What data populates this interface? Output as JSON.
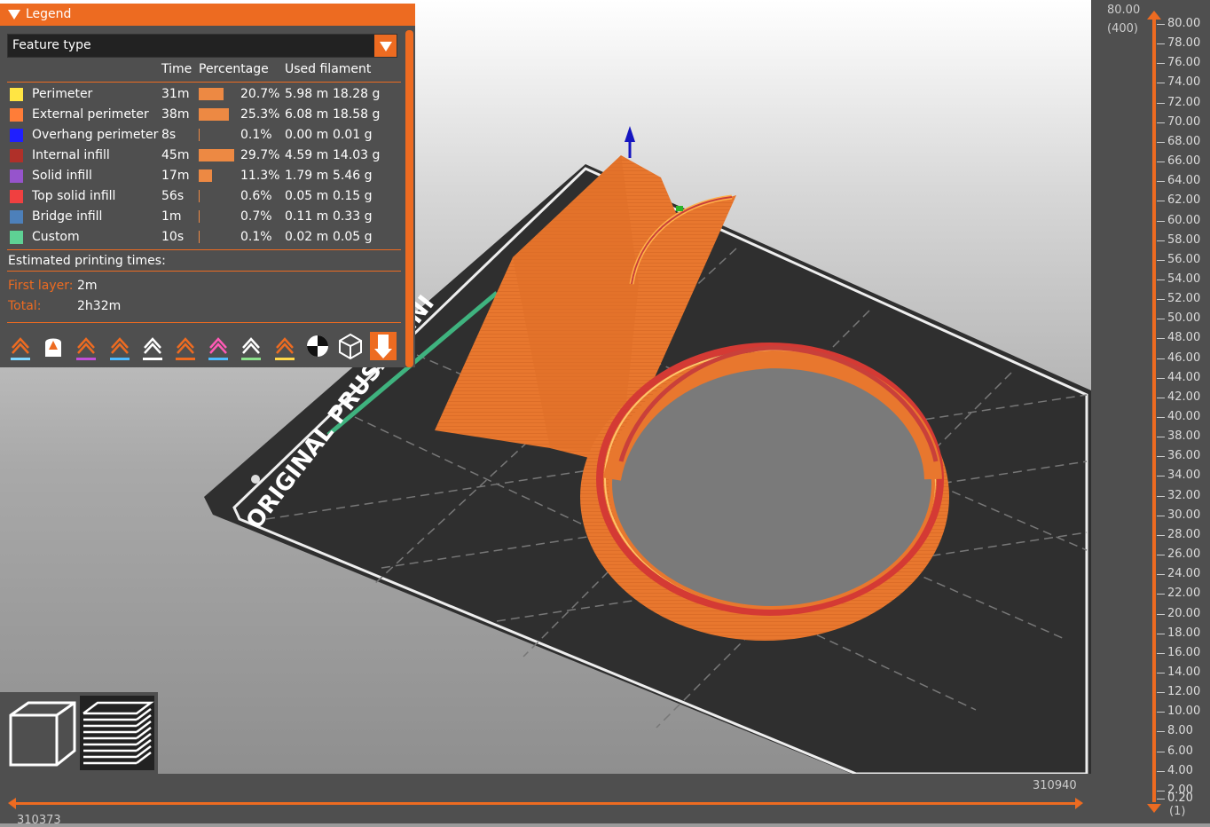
{
  "legend": {
    "title": "Legend",
    "view_type": "Feature type",
    "columns": [
      "Time",
      "Percentage",
      "Used filament"
    ],
    "rows": [
      {
        "name": "Perimeter",
        "color": "#ffe543",
        "time": "31m",
        "pct": "20.7%",
        "pct_value": 20.7,
        "length": "5.98 m",
        "weight": "18.28 g"
      },
      {
        "name": "External perimeter",
        "color": "#ff7d38",
        "time": "38m",
        "pct": "25.3%",
        "pct_value": 25.3,
        "length": "6.08 m",
        "weight": "18.58 g"
      },
      {
        "name": "Overhang perimeter",
        "color": "#1f1fff",
        "time": "8s",
        "pct": "0.1%",
        "pct_value": 0.1,
        "length": "0.00 m",
        "weight": "0.01 g"
      },
      {
        "name": "Internal infill",
        "color": "#b03029",
        "time": "45m",
        "pct": "29.7%",
        "pct_value": 29.7,
        "length": "4.59 m",
        "weight": "14.03 g"
      },
      {
        "name": "Solid infill",
        "color": "#9654cc",
        "time": "17m",
        "pct": "11.3%",
        "pct_value": 11.3,
        "length": "1.79 m",
        "weight": "5.46 g"
      },
      {
        "name": "Top solid infill",
        "color": "#f04040",
        "time": "56s",
        "pct": "0.6%",
        "pct_value": 0.6,
        "length": "0.05 m",
        "weight": "0.15 g"
      },
      {
        "name": "Bridge infill",
        "color": "#4d80ba",
        "time": "1m",
        "pct": "0.7%",
        "pct_value": 0.7,
        "length": "0.11 m",
        "weight": "0.33 g"
      },
      {
        "name": "Custom",
        "color": "#5ed194",
        "time": "10s",
        "pct": "0.1%",
        "pct_value": 0.1,
        "length": "0.02 m",
        "weight": "0.05 g"
      }
    ],
    "estimated_label": "Estimated printing times:",
    "first_layer_label": "First layer:",
    "first_layer_value": "2m",
    "total_label": "Total:",
    "total_value": "2h32m",
    "toolbar_icons": [
      "travel-icon",
      "wipe-icon",
      "retractions-icon",
      "deretractions-icon",
      "seams-icon",
      "tool-changes-icon",
      "color-changes-icon",
      "pause-prints-icon",
      "custom-gcodes-icon",
      "center-of-gravity-icon",
      "shells-icon",
      "tool-marker-icon"
    ]
  },
  "bed": {
    "label": "ORIGINAL PRUSA MINI"
  },
  "view_buttons": [
    "3d-view-icon",
    "layers-view-icon"
  ],
  "vertical_slider": {
    "top_value": "80.00",
    "top_layer": "(400)",
    "bottom_layer": "(1)",
    "ticks": [
      "80.00",
      "78.00",
      "76.00",
      "74.00",
      "72.00",
      "70.00",
      "68.00",
      "66.00",
      "64.00",
      "62.00",
      "60.00",
      "58.00",
      "56.00",
      "54.00",
      "52.00",
      "50.00",
      "48.00",
      "46.00",
      "44.00",
      "42.00",
      "40.00",
      "38.00",
      "36.00",
      "34.00",
      "32.00",
      "30.00",
      "28.00",
      "26.00",
      "24.00",
      "22.00",
      "20.00",
      "18.00",
      "16.00",
      "14.00",
      "12.00",
      "10.00",
      "8.00",
      "6.00",
      "4.00",
      "2.00",
      "0.20"
    ]
  },
  "horizontal_slider": {
    "right_value": "310940",
    "left_value": "310373"
  }
}
